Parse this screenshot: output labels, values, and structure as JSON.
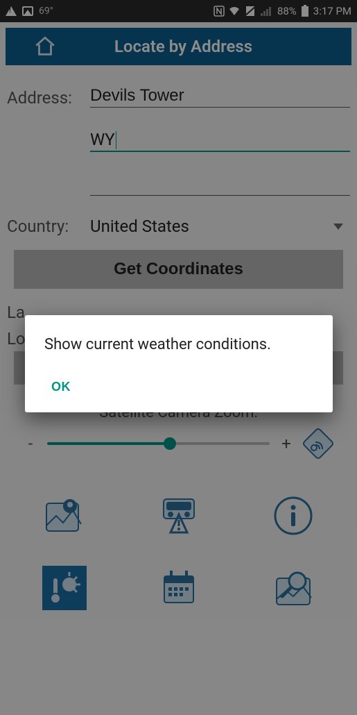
{
  "statusbar": {
    "temperature": "69°",
    "battery_pct": "88%",
    "time": "3:17 PM"
  },
  "header": {
    "title": "Locate by Address"
  },
  "form": {
    "address_label": "Address:",
    "address_line1": "Devils Tower",
    "address_line2": "WY",
    "address_line3": "",
    "country_label": "Country:",
    "country_value": "United States",
    "get_coords_label": "Get Coordinates",
    "latitude_label": "La",
    "longitude_label": "Lo"
  },
  "zoom": {
    "label": "Satellite Camera Zoom:",
    "minus": "-",
    "plus": "+",
    "value_pct": 55
  },
  "icons": {
    "map_pin": "map-pin-icon",
    "traffic": "traffic-warning-icon",
    "info": "info-icon",
    "weather": "weather-icon",
    "calendar": "calendar-icon",
    "search_map": "search-map-icon",
    "satellite": "satellite-icon"
  },
  "dialog": {
    "message": "Show current weather conditions.",
    "ok_label": "OK"
  },
  "colors": {
    "primary": "#0b5d8e",
    "accent": "#009688"
  }
}
